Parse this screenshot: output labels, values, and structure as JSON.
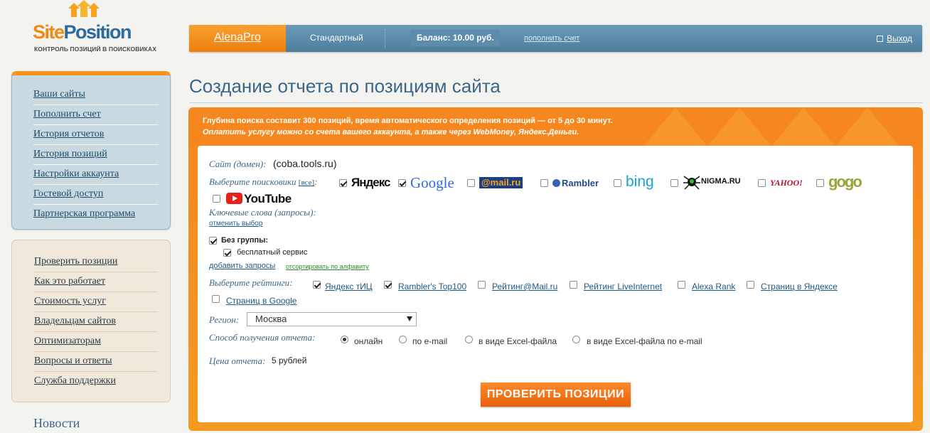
{
  "logo": {
    "brand_first": "Site",
    "brand_second": "Position",
    "tagline": "КОНТРОЛЬ ПОЗИЦИЙ В ПОИСКОВИКАХ"
  },
  "topbar": {
    "username": "AlenaPro",
    "plan": "Стандартный",
    "balance": "Баланс: 10.00 руб.",
    "topup": "пополнить счет",
    "logout": "Выход"
  },
  "sidebar": {
    "account_menu": [
      "Ваши сайты",
      "Пополнить счет",
      "История отчетов",
      "История позиций",
      "Настройки аккаунта",
      "Гостевой доступ",
      "Партнерская программа"
    ],
    "info_menu": [
      "Проверить позиции",
      "Как это работает",
      "Стоимость услуг",
      "Владельцам сайтов",
      "Оптимизаторам",
      "Вопросы и ответы",
      "Служба поддержки"
    ],
    "news": "Новости"
  },
  "main": {
    "title": "Создание отчета по позициям сайта",
    "note_line1": "Глубина поиска составит 300 позиций, время автоматического определения позиций — от 5 до 30 минут.",
    "note_line2": "Оплатить услугу можно со счета вашего аккаунта, а также через WebMoney, Яндекс.Деньги."
  },
  "form": {
    "site_label": "Сайт (домен):",
    "site_value": "(coba.tools.ru)",
    "engines_label": "Выберите поисковики",
    "engines_all": "[все]",
    "engines_colon": ":",
    "engines": [
      {
        "name": "Яндекс",
        "checked": true
      },
      {
        "name": "Google",
        "checked": true
      },
      {
        "name": "@mail.ru",
        "checked": false
      },
      {
        "name": "Rambler",
        "checked": false
      },
      {
        "name": "bing",
        "checked": false
      },
      {
        "name": "NIGMA.RU",
        "checked": false
      },
      {
        "name": "YAHOO!",
        "checked": false
      },
      {
        "name": "gogo",
        "checked": false
      },
      {
        "name": "YouTube",
        "checked": false
      }
    ],
    "keywords_label": "Ключевые слова (запросы):",
    "cancel_selection": "отменить выбор",
    "group_no_group": "Без группы:",
    "group_item": "бесплатный сервис",
    "add_queries": "добавить запросы",
    "sort_alpha": "отсортировать по алфавиту",
    "ratings_label": "Выберите рейтинги:",
    "ratings": [
      {
        "name": "Яндекс тИЦ",
        "checked": true
      },
      {
        "name": "Rambler's Top100",
        "checked": true
      },
      {
        "name": "Рейтинг@Mail.ru",
        "checked": false
      },
      {
        "name": "Рейтинг LiveInternet",
        "checked": false
      },
      {
        "name": "Alexa Rank",
        "checked": false
      },
      {
        "name": "Страниц в Яндексе",
        "checked": false
      },
      {
        "name": "Страниц в Google",
        "checked": false
      }
    ],
    "region_label": "Регион:",
    "region_value": "Москва",
    "delivery_label": "Способ получения отчета:",
    "delivery_options": [
      {
        "name": "онлайн",
        "selected": true
      },
      {
        "name": "по e-mail",
        "selected": false
      },
      {
        "name": "в виде Excel-файла",
        "selected": false
      },
      {
        "name": "в виде Excel-файла по e-mail",
        "selected": false
      }
    ],
    "price_label": "Цена отчета:",
    "price_value": "5 рублей",
    "submit": "ПРОВЕРИТЬ ПОЗИЦИИ"
  },
  "colors": {
    "accent_orange": "#f6871f",
    "header_blue": "#5a88a8",
    "title_blue": "#3c6688"
  }
}
